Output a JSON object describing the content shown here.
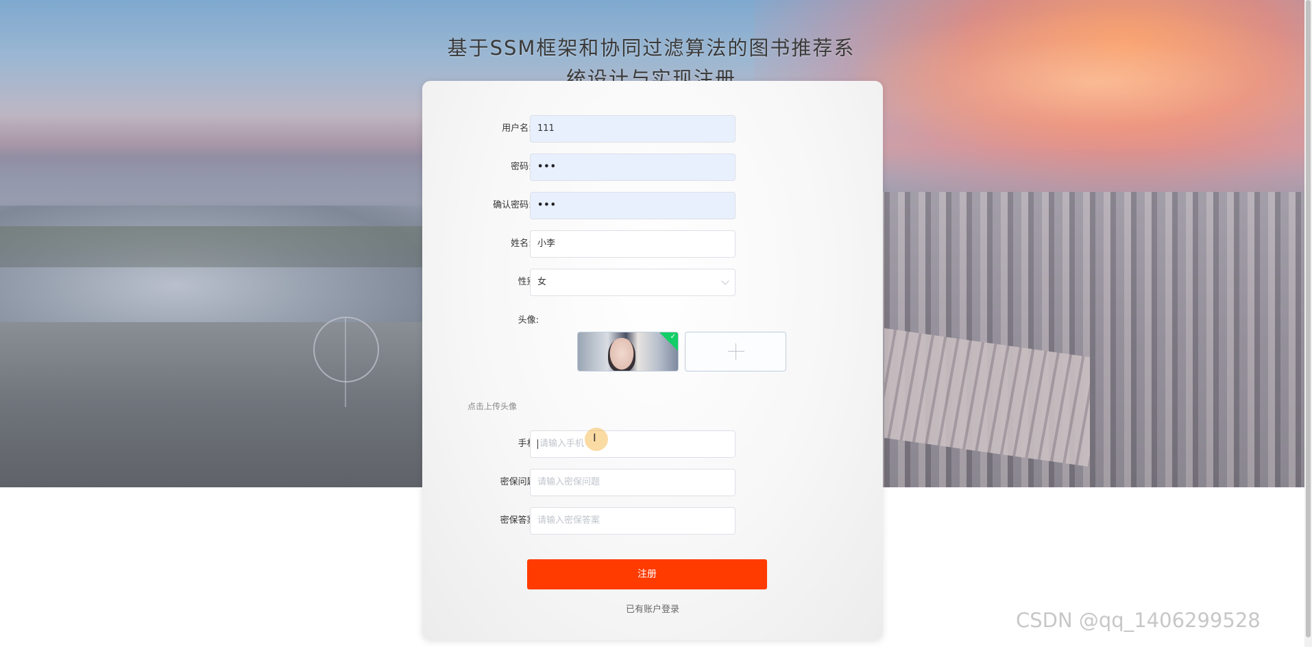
{
  "page": {
    "title_line1": "基于SSM框架和协同过滤算法的图书推荐系",
    "title_line2": "统设计与实现注册"
  },
  "form": {
    "username": {
      "label": "用户名:",
      "required": "*",
      "value": "111"
    },
    "password": {
      "label": "密码:",
      "required": "*",
      "value": "•••"
    },
    "confirm_password": {
      "label": "确认密码:",
      "required": "*",
      "value": "•••"
    },
    "name": {
      "label": "姓名:",
      "required": "*",
      "value": "小李"
    },
    "gender": {
      "label": "性别:",
      "value": "女"
    },
    "avatar": {
      "label": "头像:",
      "upload_tip": "点击上传头像"
    },
    "phone": {
      "label": "手机:",
      "placeholder": "请输入手机"
    },
    "security_question": {
      "label": "密保问题:",
      "placeholder": "请输入密保问题"
    },
    "security_answer": {
      "label": "密保答案:",
      "placeholder": "请输入密保答案"
    },
    "register_label": "注册",
    "login_link": "已有账户登录"
  },
  "watermark": "CSDN @qq_1406299528",
  "colors": {
    "primary_button": "#ff3b00",
    "required_mark": "#f56c6c",
    "upload_success_badge": "#13ce66",
    "autofill_bg": "#e8f0fe"
  },
  "icons": [
    "chevron-down-icon",
    "check-icon",
    "plus-icon",
    "text-cursor-icon"
  ]
}
